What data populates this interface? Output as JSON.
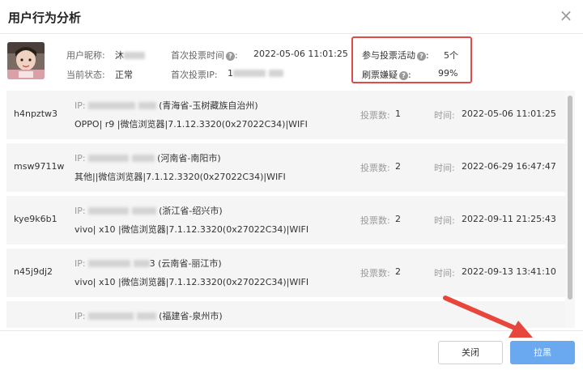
{
  "dialog": {
    "title": "用户行为分析",
    "close_icon": "close-icon",
    "close_glyph": "×"
  },
  "user": {
    "nickname_label": "用户昵称:",
    "nickname_value": "沐",
    "status_label": "当前状态:",
    "status_value": "正常",
    "first_vote_time_label": "首次投票时间",
    "first_vote_time_value": "2022-05-06 11:01:25",
    "first_vote_ip_label": "首次投票IP:",
    "first_vote_ip_value": "1",
    "activities_label": "参与投票活动",
    "activities_value": "5个",
    "fraud_label": "刷票嫌疑",
    "fraud_value": "99%",
    "help_glyph": "?",
    "colon": ":"
  },
  "records": [
    {
      "id": "h4npztw3",
      "ip_label": "IP:",
      "ip_location": "(青海省-玉树藏族自治州)",
      "device": "OPPO| r9 |微信浏览器|7.1.12.3320(0x27022C34)|WIFI",
      "vote_label": "投票数:",
      "vote_count": "1",
      "time_label": "时间:",
      "time_value": "2022-05-06 11:01:25"
    },
    {
      "id": "msw9711w",
      "ip_label": "IP:",
      "ip_location": "(河南省-南阳市)",
      "device": "其他||微信浏览器|7.1.12.3320(0x27022C34)|WIFI",
      "vote_label": "投票数:",
      "vote_count": "2",
      "time_label": "时间:",
      "time_value": "2022-06-29 16:47:47"
    },
    {
      "id": "kye9k6b1",
      "ip_label": "IP:",
      "ip_location": "(浙江省-绍兴市)",
      "device": "vivo| x10 |微信浏览器|7.1.12.3320(0x27022C34)|WIFI",
      "vote_label": "投票数:",
      "vote_count": "2",
      "time_label": "时间:",
      "time_value": "2022-09-11 21:25:43"
    },
    {
      "id": "n45j9dj2",
      "ip_label": "IP:",
      "ip_location": "3 (云南省-丽江市)",
      "device": "vivo| x10 |微信浏览器|7.1.12.3320(0x27022C34)|WIFI",
      "vote_label": "投票数:",
      "vote_count": "2",
      "time_label": "时间:",
      "time_value": "2022-09-13 13:41:10"
    },
    {
      "id": "",
      "ip_label": "IP:",
      "ip_location": "(福建省-泉州市)",
      "device": "",
      "vote_label": "",
      "vote_count": "",
      "time_label": "",
      "time_value": ""
    }
  ],
  "footer": {
    "close_label": "关闭",
    "blacklist_label": "拉黑"
  },
  "colors": {
    "highlight": "#e14b47",
    "primary_button": "#6aa8f0",
    "arrow": "#e8463c"
  }
}
